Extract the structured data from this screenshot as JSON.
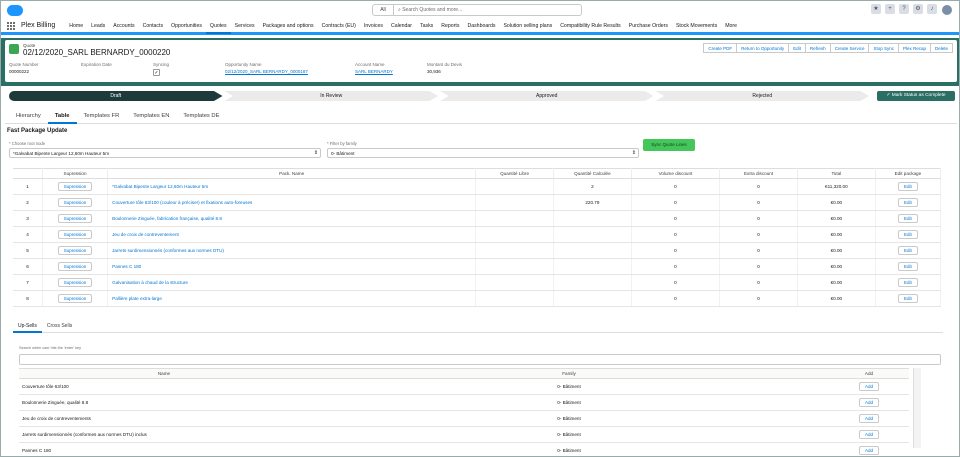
{
  "global": {
    "search_scope": "All",
    "search_placeholder": "Search Quotes and more...",
    "notif_count": "1"
  },
  "nav": {
    "app_name": "Plex Billing",
    "items": [
      "Home",
      "Leads",
      "Accounts",
      "Contacts",
      "Opportunities",
      "Quotes",
      "Services",
      "Packages and options",
      "Contracts (EU)",
      "Invoices",
      "Calendar",
      "Tasks",
      "Reports",
      "Dashboards",
      "Solution selling plans",
      "Compatibility Rule Results",
      "Purchase Orders",
      "Stock Movements",
      "More"
    ]
  },
  "record": {
    "type": "Quote",
    "title": "02/12/2020_SARL BERNARDY_0000220",
    "actions": [
      "Create PDF",
      "Return to Opportunity",
      "Edit",
      "Refresh",
      "Create Service",
      "Stop Sync",
      "Plex Recap",
      "Delete"
    ],
    "fields": [
      {
        "label": "Quote Number",
        "value": "00000222"
      },
      {
        "label": "Expiration Date",
        "value": ""
      },
      {
        "label": "Syncing",
        "value": "✓"
      },
      {
        "label": "Opportunity Name",
        "value": "02/12/2020_SARL BERNARDY_0000187"
      },
      {
        "label": "Account Name",
        "value": "SARL BERNARDY"
      },
      {
        "label": "Montant du Devis",
        "value": "30,936"
      }
    ]
  },
  "path": {
    "steps": [
      "Draft",
      "In Review",
      "Approved",
      "Rejected"
    ],
    "mark_button": "✓ Mark Status as Complete"
  },
  "tabs": [
    "Hierarchy",
    "Table",
    "Templates FR",
    "Templates EN",
    "Templates DE"
  ],
  "fast": {
    "title": "Fast Package Update",
    "root_label": "* Choose root node",
    "root_value": "*Galvabat Bipente Largeur 12,60m Hauteur 5m",
    "family_label": "* Filter by family",
    "family_value": "0- Bâtiment",
    "sync_button": "Sync Quote Lines"
  },
  "packages": {
    "headers": [
      "Supression",
      "Pack. Name",
      "Quantité Libre",
      "Quantité Calculée",
      "Volume discount",
      "Extra discount",
      "Total",
      "Edit package"
    ],
    "rows": [
      {
        "n": "1",
        "btn": "Supression",
        "name": "*Galvabat Bipente Largeur 12,60m Hauteur 5m",
        "ql": "",
        "qc": "2",
        "vd": "0",
        "ed": "0",
        "total": "€11,320.00",
        "edit": "Edit"
      },
      {
        "n": "2",
        "btn": "Supression",
        "name": "Couverture tôle 63/100 (couleur à préciser) et fixations auto-foreuses",
        "ql": "",
        "qc": "220.79",
        "vd": "0",
        "ed": "0",
        "total": "€0.00",
        "edit": "Edit"
      },
      {
        "n": "3",
        "btn": "Supression",
        "name": "Boulonnerie Zinguée, fabrication française, qualité 8.8",
        "ql": "",
        "qc": "",
        "vd": "0",
        "ed": "0",
        "total": "€0.00",
        "edit": "Edit"
      },
      {
        "n": "4",
        "btn": "Supression",
        "name": "Jeu de croix de contreventement",
        "ql": "",
        "qc": "",
        "vd": "0",
        "ed": "0",
        "total": "€0.00",
        "edit": "Edit"
      },
      {
        "n": "5",
        "btn": "Supression",
        "name": "Jarrets surdimensionnés (conformes aux normes DTU)",
        "ql": "",
        "qc": "",
        "vd": "0",
        "ed": "0",
        "total": "€0.00",
        "edit": "Edit"
      },
      {
        "n": "6",
        "btn": "Supression",
        "name": "Pannes C 180",
        "ql": "",
        "qc": "",
        "vd": "0",
        "ed": "0",
        "total": "€0.00",
        "edit": "Edit"
      },
      {
        "n": "7",
        "btn": "Supression",
        "name": "Galvanisation à chaud de la structure",
        "ql": "",
        "qc": "",
        "vd": "0",
        "ed": "0",
        "total": "€0.00",
        "edit": "Edit"
      },
      {
        "n": "8",
        "btn": "Supression",
        "name": "Pallière plate extra-large",
        "ql": "",
        "qc": "",
        "vd": "0",
        "ed": "0",
        "total": "€0.00",
        "edit": "Edit"
      }
    ]
  },
  "sells": {
    "tabs": [
      "Up-Sells",
      "Cross Sells"
    ],
    "hint": "Search when user hits the 'enter' key",
    "headers": [
      "Name",
      "Family",
      "Add"
    ],
    "rows": [
      {
        "name": "Couverture tôle 63/100",
        "family": "0- Bâtiment",
        "add": "Add"
      },
      {
        "name": "Boulonnerie Zinguée, qualité 8.8",
        "family": "0- Bâtiment",
        "add": "Add"
      },
      {
        "name": "Jeu de croix de contreventements",
        "family": "0- Bâtiment",
        "add": "Add"
      },
      {
        "name": "Jarrets surdimensionnés (conformes aux normes DTU) inclus",
        "family": "0- Bâtiment",
        "add": "Add"
      },
      {
        "name": "Pannes C 180",
        "family": "0- Bâtiment",
        "add": "Add"
      }
    ]
  }
}
